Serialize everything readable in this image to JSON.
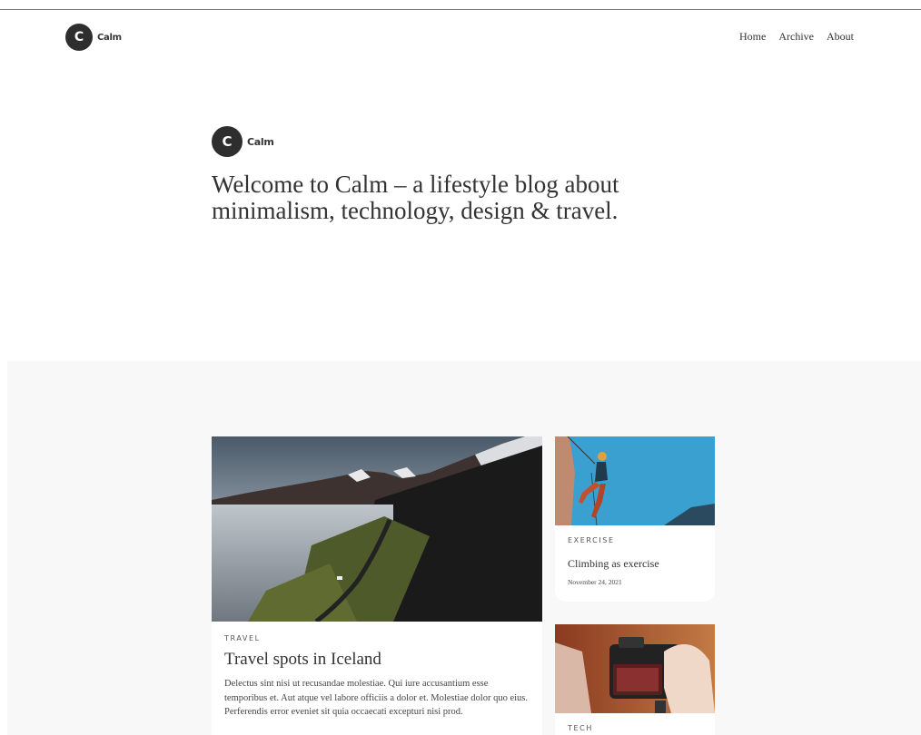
{
  "site": {
    "logo_letter": "C",
    "logo_name": "Calm"
  },
  "nav": {
    "items": [
      {
        "label": "Home"
      },
      {
        "label": "Archive"
      },
      {
        "label": "About"
      }
    ]
  },
  "hero": {
    "logo_letter": "C",
    "logo_name": "Calm",
    "title": "Welcome to Calm – a lifestyle blog about minimalism, technology, design & travel."
  },
  "posts": [
    {
      "tag": "TRAVEL",
      "title": "Travel spots in Iceland",
      "excerpt": "Delectus sint nisi ut recusandae molestiae. Qui iure accusantium esse temporibus et. Aut atque vel labore officiis a dolor et. Molestiae dolor quo eius. Perferendis error eveniet sit quia occaecati excepturi nisi prod."
    },
    {
      "tag": "EXERCISE",
      "title": "Climbing as exercise",
      "date": "November 24, 2021"
    },
    {
      "tag": "TECH"
    }
  ],
  "colors": {
    "background": "#ffffff",
    "feed_background": "#f8f8f8",
    "text": "#333333",
    "logo_circle": "#2e2e2e"
  }
}
